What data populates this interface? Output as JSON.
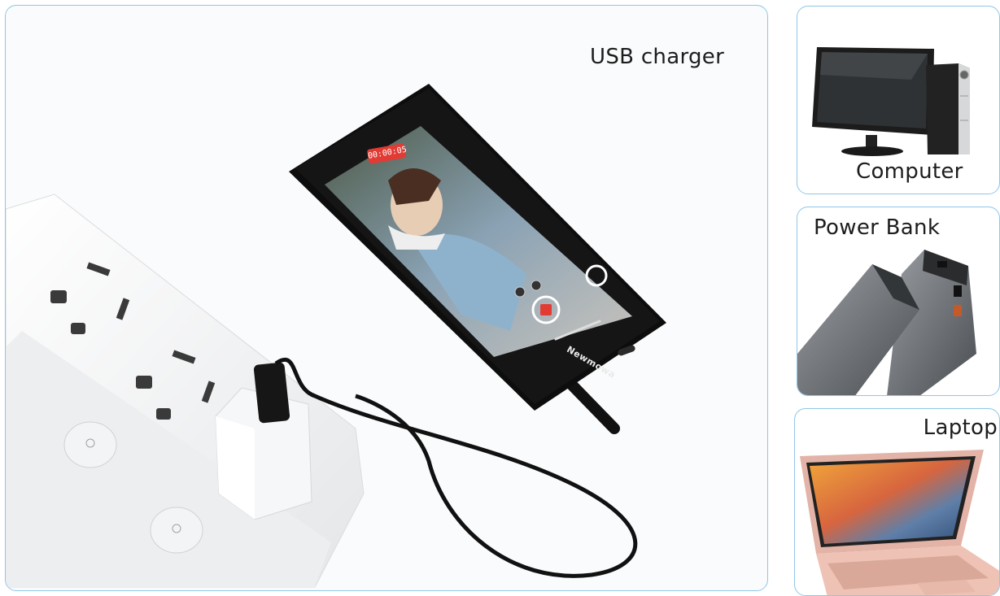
{
  "panels": {
    "main": {
      "label": "USB charger"
    },
    "computer": {
      "label": "Computer"
    },
    "power_bank": {
      "label": "Power Bank"
    },
    "laptop": {
      "label": "Laptop"
    }
  },
  "device": {
    "brand": "Newmowa",
    "recording_time": "00:00:05"
  },
  "colors": {
    "panel_border": "#8fc7e6",
    "record_red": "#e23b34",
    "device_black": "#111111",
    "laptop_pink": "#e6b7a9"
  }
}
